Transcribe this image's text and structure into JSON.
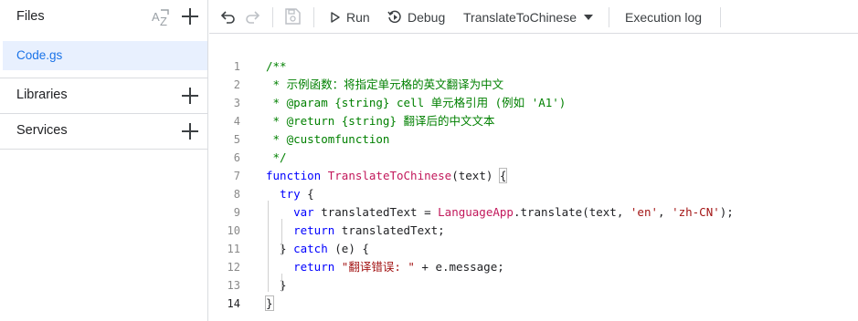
{
  "sidebar": {
    "files_title": "Files",
    "file_name": "Code.gs",
    "libraries_label": "Libraries",
    "services_label": "Services"
  },
  "toolbar": {
    "run_label": "Run",
    "debug_label": "Debug",
    "function_name": "TranslateToChinese",
    "execution_log_label": "Execution log"
  },
  "editor": {
    "lines": [
      {
        "num": "1",
        "parts": [
          {
            "t": "/**",
            "c": "cmt"
          }
        ]
      },
      {
        "num": "2",
        "parts": [
          {
            "t": " * 示例函数：将指定单元格的英文翻译为中文",
            "c": "cmt"
          }
        ]
      },
      {
        "num": "3",
        "parts": [
          {
            "t": " * @param {string} cell 单元格引用 (例如 'A1')",
            "c": "cmt"
          }
        ]
      },
      {
        "num": "4",
        "parts": [
          {
            "t": " * @return {string} 翻译后的中文文本",
            "c": "cmt"
          }
        ]
      },
      {
        "num": "5",
        "parts": [
          {
            "t": " * @customfunction",
            "c": "cmt"
          }
        ]
      },
      {
        "num": "6",
        "parts": [
          {
            "t": " */",
            "c": "cmt"
          }
        ]
      },
      {
        "num": "7",
        "parts": [
          {
            "t": "function",
            "c": "kw"
          },
          {
            "t": " ",
            "c": ""
          },
          {
            "t": "TranslateToChinese",
            "c": "cls"
          },
          {
            "t": "(text) ",
            "c": ""
          },
          {
            "t": "{",
            "c": "hl"
          }
        ]
      },
      {
        "num": "8",
        "parts": [
          {
            "t": "  ",
            "c": ""
          },
          {
            "t": "try",
            "c": "kw"
          },
          {
            "t": " {",
            "c": ""
          }
        ]
      },
      {
        "num": "9",
        "parts": [
          {
            "t": "    ",
            "c": ""
          },
          {
            "t": "var",
            "c": "kw"
          },
          {
            "t": " translatedText = ",
            "c": ""
          },
          {
            "t": "LanguageApp",
            "c": "cls"
          },
          {
            "t": ".translate(text, ",
            "c": ""
          },
          {
            "t": "'en'",
            "c": "str"
          },
          {
            "t": ", ",
            "c": ""
          },
          {
            "t": "'zh-CN'",
            "c": "str"
          },
          {
            "t": ");",
            "c": ""
          }
        ]
      },
      {
        "num": "10",
        "parts": [
          {
            "t": "    ",
            "c": ""
          },
          {
            "t": "return",
            "c": "kw"
          },
          {
            "t": " translatedText;",
            "c": ""
          }
        ]
      },
      {
        "num": "11",
        "parts": [
          {
            "t": "  } ",
            "c": ""
          },
          {
            "t": "catch",
            "c": "kw"
          },
          {
            "t": " (e) {",
            "c": ""
          }
        ]
      },
      {
        "num": "12",
        "parts": [
          {
            "t": "    ",
            "c": ""
          },
          {
            "t": "return",
            "c": "kw"
          },
          {
            "t": " ",
            "c": ""
          },
          {
            "t": "\"翻译错误: \"",
            "c": "str"
          },
          {
            "t": " + e.message;",
            "c": ""
          }
        ]
      },
      {
        "num": "13",
        "parts": [
          {
            "t": "  }",
            "c": ""
          }
        ]
      },
      {
        "num": "14",
        "parts": [
          {
            "t": "}",
            "c": "hl"
          }
        ]
      }
    ],
    "active_line": "14"
  },
  "colors": {
    "comment": "#008000",
    "keyword": "#0000ff",
    "identifier": "#c2185b",
    "string": "#a31515",
    "accent": "#1a73e8",
    "selected_bg": "#e8f0fe"
  }
}
